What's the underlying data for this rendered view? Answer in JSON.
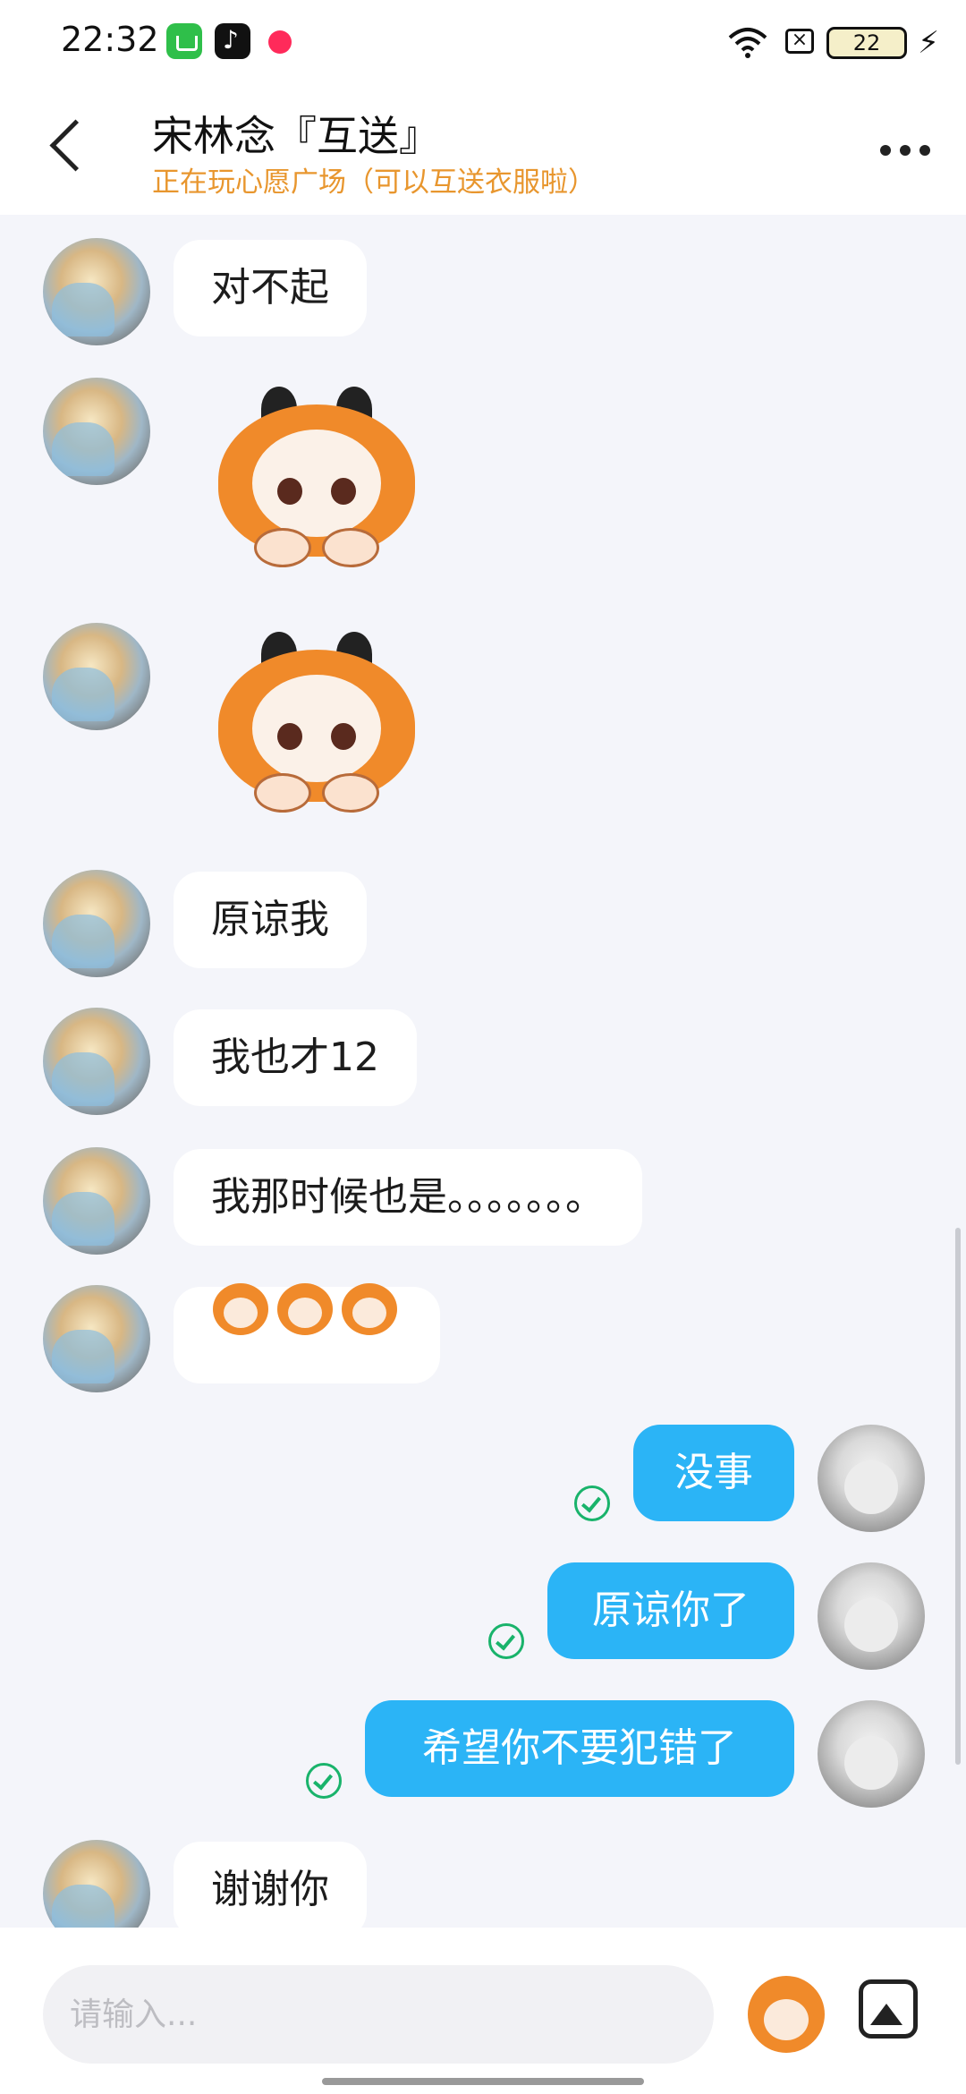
{
  "status_bar": {
    "time": "22:32",
    "battery": "22"
  },
  "header": {
    "title": "宋林念『互送』",
    "subtitle": "正在玩心愿广场（可以互送衣服啦）"
  },
  "messages": [
    {
      "side": "in",
      "type": "text",
      "text": "对不起"
    },
    {
      "side": "in",
      "type": "sticker",
      "sticker": "sad-chibi-sticker"
    },
    {
      "side": "in",
      "type": "sticker",
      "sticker": "sad-chibi-sticker"
    },
    {
      "side": "in",
      "type": "text",
      "text": "原谅我"
    },
    {
      "side": "in",
      "type": "text",
      "text": "我也才12"
    },
    {
      "side": "in",
      "type": "text",
      "text": "我那时候也是。。。。。。。"
    },
    {
      "side": "in",
      "type": "emoji",
      "emojis": [
        "crying-chibi-emoji",
        "crying-chibi-emoji",
        "crying-chibi-emoji"
      ]
    },
    {
      "side": "out",
      "type": "text",
      "text": "没事",
      "status": "read"
    },
    {
      "side": "out",
      "type": "text",
      "text": "原谅你了",
      "status": "read"
    },
    {
      "side": "out",
      "type": "text",
      "text": "希望你不要犯错了",
      "status": "read"
    },
    {
      "side": "in",
      "type": "text",
      "text": "谢谢你"
    }
  ],
  "input": {
    "placeholder": "请输入..."
  },
  "colors": {
    "accent_orange": "#e8962e",
    "outgoing_bubble": "#2bb4f6",
    "read_check": "#19b36b"
  }
}
